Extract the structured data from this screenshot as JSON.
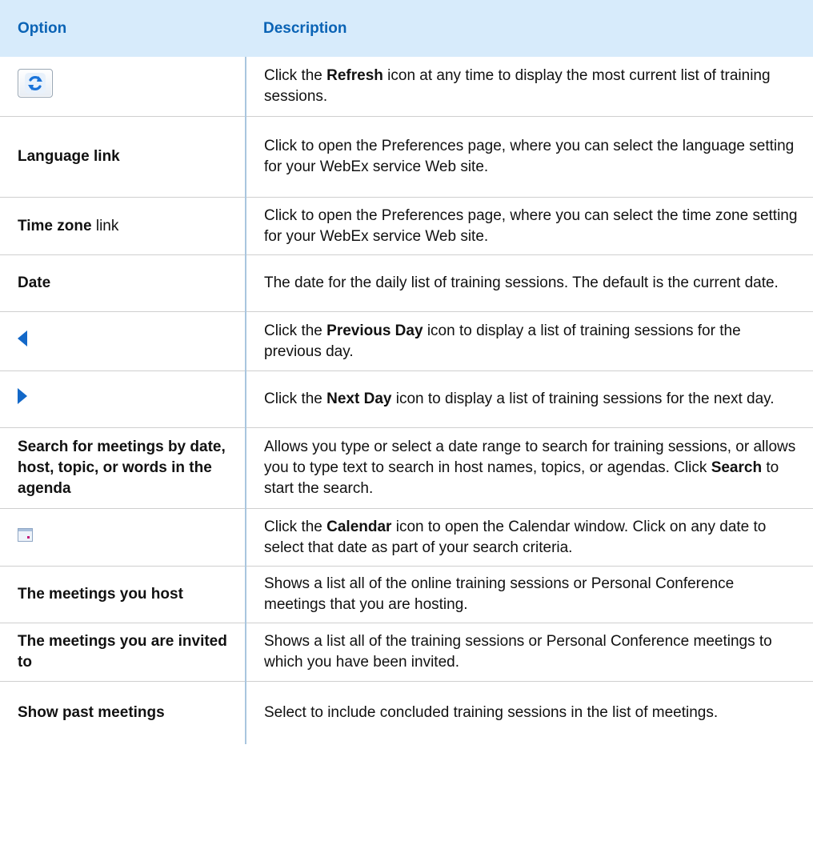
{
  "header": {
    "option": "Option",
    "description": "Description"
  },
  "rows": [
    {
      "option_icon": "refresh-icon",
      "desc": {
        "p1": "Click the ",
        "b1": "Refresh",
        "p2": " icon at any time to display the most current list of training sessions."
      }
    },
    {
      "option_bold": "Language link",
      "desc": {
        "p1": "Click to open the Preferences page, where you can select the language setting for your WebEx service Web site."
      }
    },
    {
      "option_bold": "Time zone",
      "option_plain": " link",
      "desc": {
        "p1": "Click to open the Preferences page, where you can select the time zone setting for your WebEx service Web site."
      }
    },
    {
      "option_bold": "Date",
      "desc": {
        "p1": "The date for the daily list of training sessions. The default is the current date."
      }
    },
    {
      "option_icon": "previous-day-icon",
      "desc": {
        "p1": "Click the ",
        "b1": "Previous Day",
        "p2": " icon to display a list of training sessions for the previous day."
      }
    },
    {
      "option_icon": "next-day-icon",
      "desc": {
        "p1": "Click the ",
        "b1": "Next Day",
        "p2": " icon to display a list of training sessions for the next day."
      }
    },
    {
      "option_bold": "Search for meetings by date, host, topic, or words in the agenda",
      "desc": {
        "p1": "Allows you type or select a date range to search for training sessions, or allows you to type text to search in host names, topics, or agendas. Click ",
        "b1": "Search",
        "p2": " to start the search."
      }
    },
    {
      "option_icon": "calendar-icon",
      "desc": {
        "p1": "Click the ",
        "b1": "Calendar",
        "p2": " icon to open the Calendar window. Click on any date to select that date as part of your search criteria."
      }
    },
    {
      "option_bold": "The meetings you host",
      "desc": {
        "p1": "Shows a list all of the online training sessions or Personal Conference meetings that you are hosting."
      }
    },
    {
      "option_bold": "The meetings you are invited to",
      "desc": {
        "p1": "Shows a list all of the training sessions or Personal Conference meetings to which you have been invited."
      }
    },
    {
      "option_bold": "Show past meetings",
      "desc": {
        "p1": "Select to include concluded training sessions in the list of meetings."
      }
    }
  ],
  "colors": {
    "header_bg": "#d7ebfb",
    "header_text": "#0a63b5",
    "icon_blue": "#1368c8"
  }
}
